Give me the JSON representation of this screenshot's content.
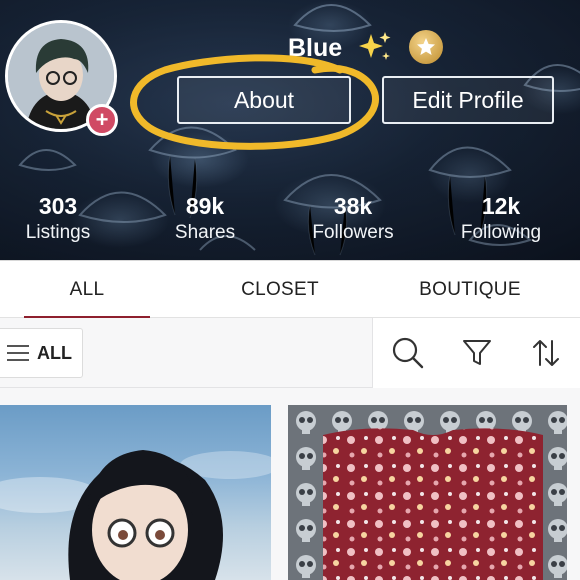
{
  "profile": {
    "username": "Blue",
    "about_label": "About",
    "edit_profile_label": "Edit Profile",
    "avatar_add_symbol": "+",
    "badge_icon": "star-icon",
    "sparkle_icon": "sparkles-icon"
  },
  "stats": [
    {
      "value": "303",
      "label": "Listings"
    },
    {
      "value": "89k",
      "label": "Shares"
    },
    {
      "value": "38k",
      "label": "Followers"
    },
    {
      "value": "12k",
      "label": "Following"
    }
  ],
  "tabs": [
    {
      "label": "ALL",
      "active": true
    },
    {
      "label": "CLOSET",
      "active": false
    },
    {
      "label": "BOUTIQUE",
      "active": false
    }
  ],
  "filter": {
    "selected": "ALL",
    "menu_icon": "menu-icon",
    "tools": [
      "search-icon",
      "filter-icon",
      "sort-icon"
    ]
  },
  "colors": {
    "accent": "#8e1f2d",
    "avatar_add": "#d04a64",
    "annotation": "#f0b92a"
  }
}
